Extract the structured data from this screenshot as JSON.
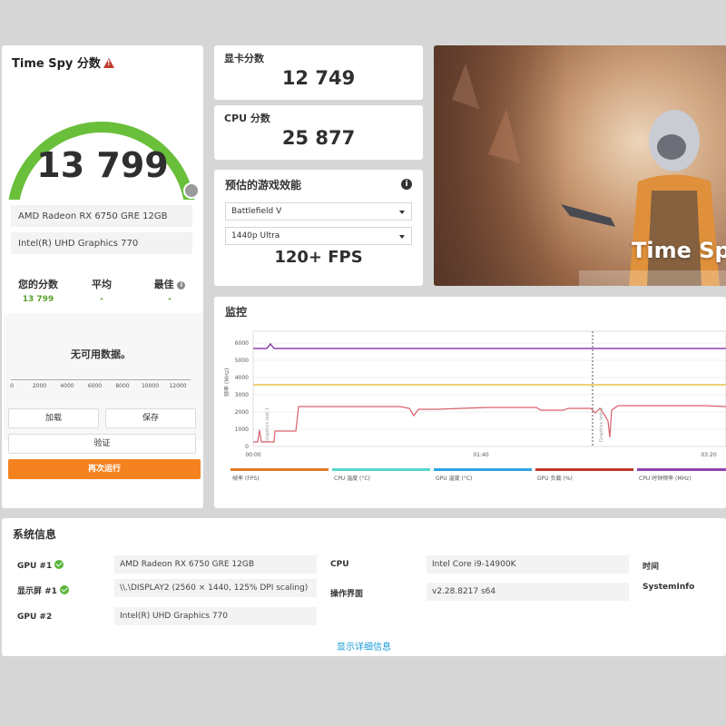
{
  "score_card": {
    "title": "Time Spy 分数",
    "total_score": "13 799",
    "gpu_name": "AMD Radeon RX 6750 GRE 12GB",
    "igpu_name": "Intel(R) UHD Graphics 770",
    "stats": {
      "yours_label": "您的分数",
      "yours_value": "13 799",
      "avg_label": "平均",
      "avg_value": "-",
      "best_label": "最佳",
      "best_value": "-"
    },
    "no_data": "无可用数据。",
    "axis_ticks": [
      "0",
      "2000",
      "4000",
      "6000",
      "8000",
      "10000",
      "12000"
    ],
    "buttons": {
      "load": "加载",
      "save": "保存",
      "validate": "验证",
      "rerun": "再次运行"
    },
    "gauge_color": "#6abf3a",
    "accent_color": "#f58220"
  },
  "graphics_score": {
    "label": "显卡分数",
    "value": "12 749"
  },
  "cpu_score": {
    "label": "CPU 分数",
    "value": "25 877"
  },
  "game_perf": {
    "title": "预估的游戏效能",
    "game": "Battlefield V",
    "preset": "1440p Ultra",
    "fps": "120+ FPS"
  },
  "banner": {
    "title": "Time Spy"
  },
  "monitoring": {
    "title": "监控",
    "y_label": "频率 (MHz)",
    "y_ticks": [
      "0",
      "1000",
      "2000",
      "3000",
      "4000",
      "5000",
      "6000"
    ],
    "x_ticks": [
      "00:00",
      "01:40",
      "03:20"
    ],
    "marker_label_1": "Graphics test 1",
    "marker_label_2": "Graphics test 2",
    "legend": [
      {
        "label": "帧率 (FPS)",
        "color": "#e07b28"
      },
      {
        "label": "CPU 温度 (°C)",
        "color": "#55d6c9"
      },
      {
        "label": "GPU 温度 (°C)",
        "color": "#2ba6de"
      },
      {
        "label": "GPU 负载 (%)",
        "color": "#c0392b"
      },
      {
        "label": "CPU 时钟频率 (MHz)",
        "color": "#8e44ad"
      }
    ]
  },
  "system_info": {
    "title": "系统信息",
    "gpu1_label": "GPU #1",
    "gpu1_value": "AMD Radeon RX 6750 GRE 12GB",
    "display1_label": "显示屏 #1",
    "display1_value": "\\\\.\\DISPLAY2 (2560 × 1440, 125% DPI scaling)",
    "gpu2_label": "GPU #2",
    "gpu2_value": "Intel(R) UHD Graphics 770",
    "cpu_label": "CPU",
    "cpu_value": "Intel Core i9-14900K",
    "gui_label": "操作界面",
    "gui_value": "v2.28.8217 s64",
    "time_label": "时间",
    "sysinfo_label": "SystemInfo",
    "details_link": "显示详细信息"
  }
}
